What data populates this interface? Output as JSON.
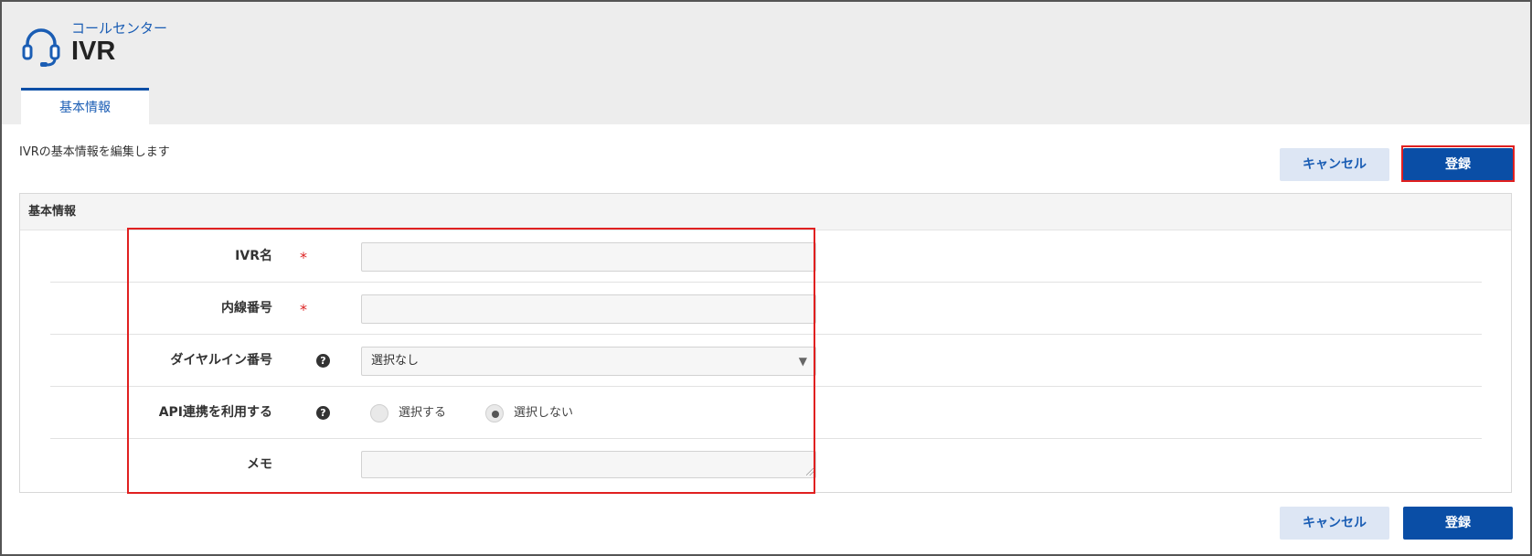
{
  "header": {
    "subtitle": "コールセンター",
    "title": "IVR",
    "icon": "headset-icon"
  },
  "tabs": [
    {
      "label": "基本情報",
      "active": true
    }
  ],
  "description": "IVRの基本情報を編集します",
  "actions": {
    "cancel_label": "キャンセル",
    "register_label": "登録"
  },
  "panel": {
    "title": "基本情報",
    "fields": {
      "ivr_name": {
        "label": "IVR名",
        "required_mark": "*",
        "value": ""
      },
      "extension": {
        "label": "内線番号",
        "required_mark": "*",
        "value": ""
      },
      "dial_in": {
        "label": "ダイヤルイン番号",
        "help_glyph": "?",
        "selected": "選択なし"
      },
      "api": {
        "label": "API連携を利用する",
        "help_glyph": "?",
        "options": [
          {
            "label": "選択する",
            "checked": false
          },
          {
            "label": "選択しない",
            "checked": true
          }
        ]
      },
      "memo": {
        "label": "メモ",
        "value": ""
      }
    }
  },
  "colors": {
    "accent": "#0a4ea6",
    "highlight": "#e02020",
    "header_bg": "#ededed"
  }
}
